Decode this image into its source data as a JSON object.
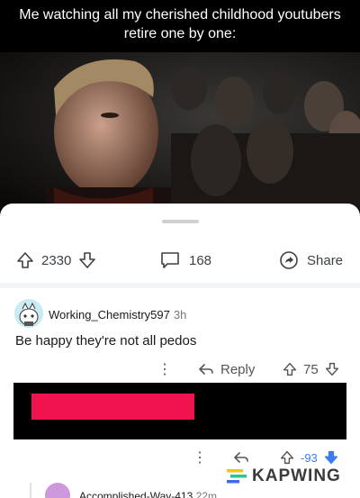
{
  "meme": {
    "caption_line1": "Me watching all my cherished childhood youtubers",
    "caption_line2": "retire one by one:"
  },
  "video": {
    "pause_icon": "pause-icon",
    "volume_icon": "volume-icon"
  },
  "post_actions": {
    "upvotes": "2330",
    "comments": "168",
    "share_label": "Share"
  },
  "comment": {
    "author": "Working_Chemistry597",
    "age": "3h",
    "text": "Be happy they're not all pedos",
    "reply_label": "Reply",
    "score": "75"
  },
  "reply": {
    "score": "-93",
    "author": "Accomplished-Way-413",
    "age": "22m"
  },
  "watermark": {
    "text": "KAPWING"
  },
  "colors": {
    "redacted_bar": "#f0134d",
    "downvote_active": "#3b7cf0"
  }
}
